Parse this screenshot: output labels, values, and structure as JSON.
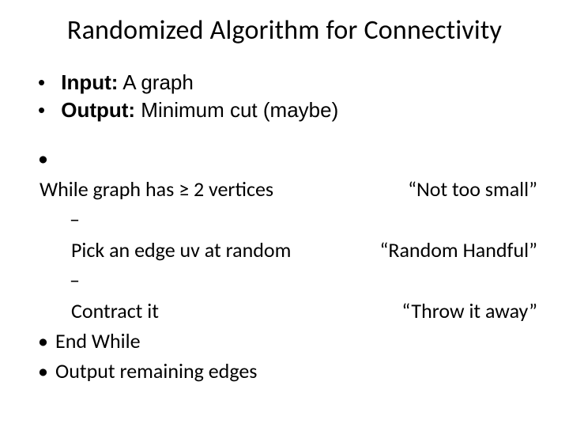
{
  "title": "Randomized Algorithm for Connectivity",
  "io": {
    "input_label": "Input:",
    "input_value": " A graph",
    "output_label": "Output:",
    "output_value": " Minimum cut  (maybe)"
  },
  "steps": {
    "while_line": "While graph has ≥ 2 vertices",
    "pick_line": "Pick an edge uv at random",
    "contract_line": "Contract it",
    "end_while": "End While",
    "output_line": "Output remaining edges"
  },
  "notes": {
    "not_too_small": "“Not too small”",
    "random_handful": "“Random Handful”",
    "throw_away": "“Throw it away”"
  }
}
